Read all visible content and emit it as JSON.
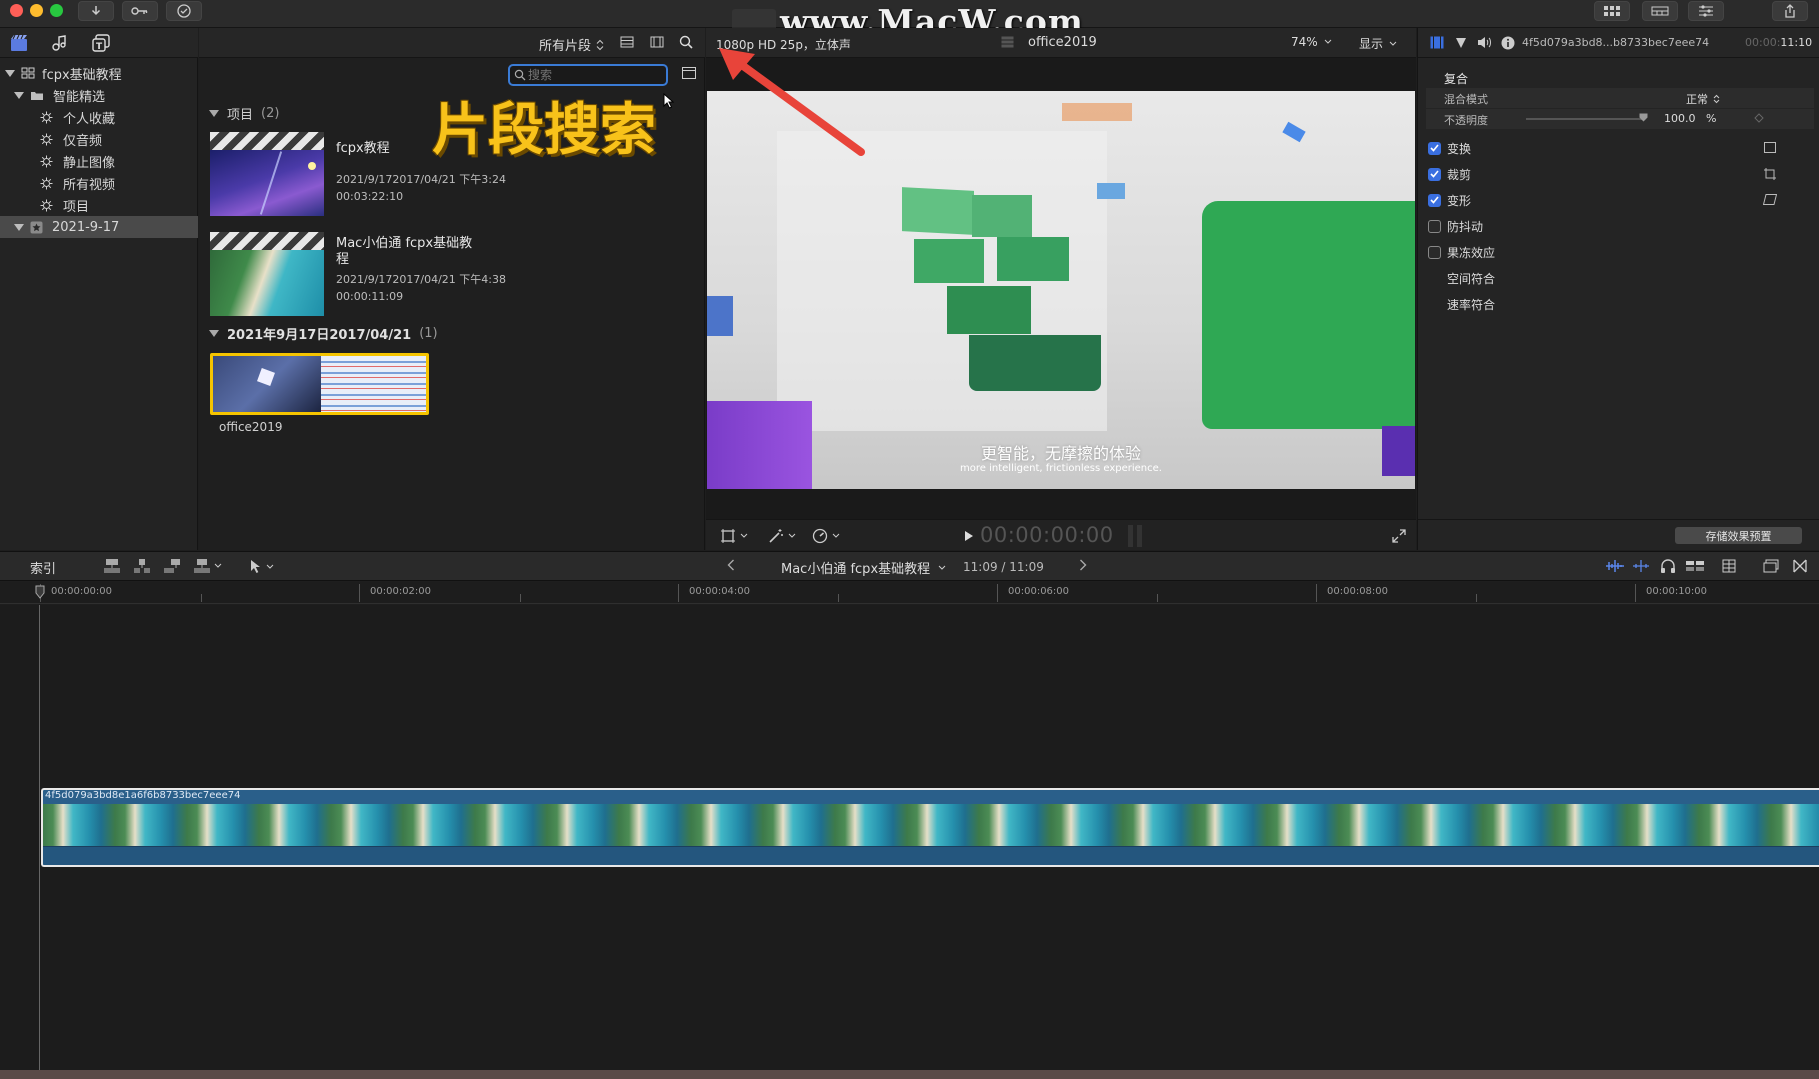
{
  "watermark": "www.MacW.com",
  "annotation_label": "片段搜索",
  "colors": {
    "accent_blue": "#3a6fe0",
    "selection_yellow": "#f5c400",
    "annotation_gold": "#f8c21a",
    "arrow_red": "#e8443a",
    "clip_blue": "#2a5f8a"
  },
  "sidebar": {
    "library": "fcpx基础教程",
    "smart_folder": "智能精选",
    "items": [
      "个人收藏",
      "仅音频",
      "静止图像",
      "所有视频",
      "项目"
    ],
    "event": "2021-9-17"
  },
  "browser": {
    "filter_label": "所有片段",
    "search_placeholder": "搜索",
    "group1": {
      "title": "项目",
      "count": "(2)"
    },
    "clips": [
      {
        "title": "fcpx教程",
        "date": "2021/9/172017/04/21 下午3:24",
        "duration": "00:03:22:10"
      },
      {
        "title": "Mac小伯通 fcpx基础教程",
        "date": "2021/9/172017/04/21 下午4:38",
        "duration": "00:00:11:09"
      }
    ],
    "group2": {
      "title": "2021年9月17日2017/04/21",
      "count": "(1)"
    },
    "event_clip": {
      "title": "office2019"
    }
  },
  "viewer": {
    "format": "1080p HD 25p，立体声",
    "clip_name": "office2019",
    "zoom": "74%",
    "display_label": "显示",
    "caption_cn": "更智能，无摩擦的体验",
    "caption_en": "more intelligent, frictionless experience.",
    "timecode": "00:00:00:00"
  },
  "inspector": {
    "clip_id": "4f5d079a3bd8...b8733bec7eee74",
    "clip_time_dim": "00:00:",
    "clip_time": "11:10",
    "section_title": "复合",
    "blend_mode_label": "混合模式",
    "blend_mode_value": "正常",
    "opacity_label": "不透明度",
    "opacity_value": "100.0",
    "opacity_unit": "%",
    "opacity_level": 1.0,
    "rows": [
      {
        "label": "变换",
        "checked": true
      },
      {
        "label": "裁剪",
        "checked": true
      },
      {
        "label": "变形",
        "checked": true
      },
      {
        "label": "防抖动",
        "checked": false
      },
      {
        "label": "果冻效应",
        "checked": false
      },
      {
        "label": "空间符合"
      },
      {
        "label": "速率符合"
      }
    ],
    "save_preset_button": "存储效果预置"
  },
  "timeline": {
    "index_label": "索引",
    "project_name": "Mac小伯通 fcpx基础教程",
    "position": "11:09 / 11:09",
    "ruler": [
      "00:00:00:00",
      "00:00:02:00",
      "00:00:04:00",
      "00:00:06:00",
      "00:00:08:00",
      "00:00:10:00"
    ],
    "clip_name": "4f5d079a3bd8e1a6f6b8733bec7eee74"
  }
}
